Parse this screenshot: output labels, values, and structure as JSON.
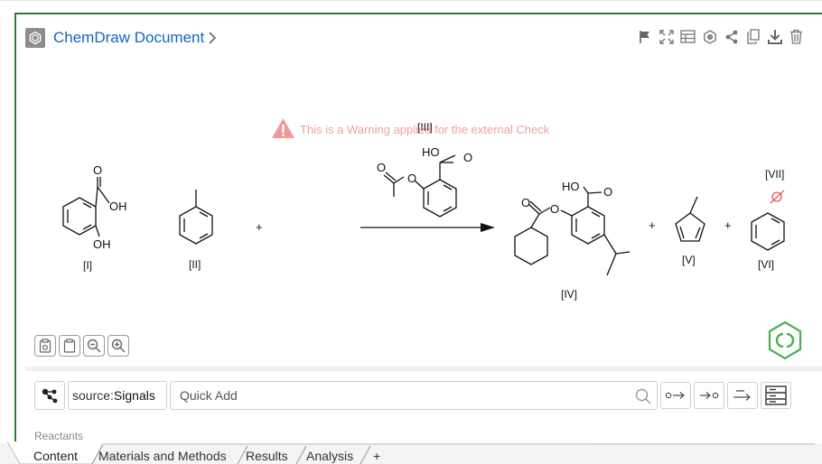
{
  "document": {
    "title": "ChemDraw Document",
    "icons": [
      "doc-icon",
      "chevron-right-icon"
    ]
  },
  "toolbar": {
    "icons": [
      "flag-icon",
      "expand-icon",
      "table-icon",
      "hexagon-icon",
      "share-icon",
      "copy-icon",
      "download-icon",
      "trash-icon"
    ]
  },
  "warning": {
    "text": "This is a Warning applied for the external Check",
    "color": "#f0a0a0"
  },
  "reaction": {
    "labels": {
      "c1": "[I]",
      "c2": "[II]",
      "c3": "[III]",
      "c4": "[IV]",
      "c5": "[V]",
      "c6": "[VI]",
      "c7": "[VII]"
    },
    "atoms": {
      "o": "O",
      "oh": "OH",
      "ho": "HO"
    },
    "plus": "+"
  },
  "inputbar": {
    "source_key": "source:",
    "source_value": "Signals",
    "quick_add_placeholder": "Quick Add"
  },
  "section": {
    "reactants": "Reactants"
  },
  "tabs": [
    {
      "label": "Content"
    },
    {
      "label": "Materials and Methods"
    },
    {
      "label": "Results"
    },
    {
      "label": "Analysis"
    },
    {
      "label": "+"
    }
  ],
  "colors": {
    "accent": "#1565c0",
    "frame": "#2e7d32",
    "badge": "#4caf50",
    "warning": "#f0a0a0"
  }
}
